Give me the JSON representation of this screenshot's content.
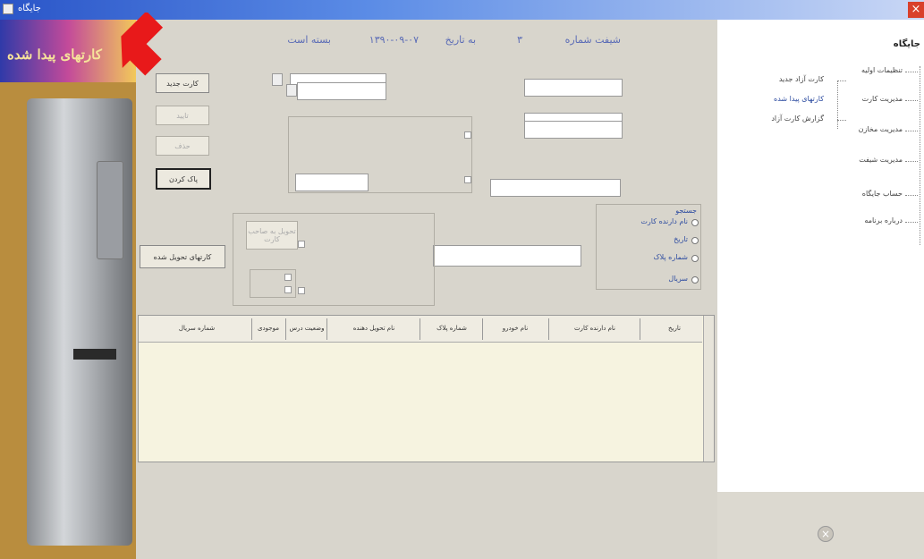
{
  "window": {
    "title": "جایگاه",
    "close_glyph": "×"
  },
  "status_bar": {
    "shift_label": "شیفت شماره",
    "shift_number": "۳",
    "date_label": "به تاریخ",
    "date_value": "۱۳۹۰-۰۹-۰۷",
    "closed_label": "بسته است"
  },
  "banner": {
    "text": "کارتهای پیدا شده"
  },
  "buttons": {
    "new_card": "کارت جدید",
    "save": "تایید",
    "delete": "حذف",
    "clear": "پاک کردن",
    "delivered_cards": "کارتهای تحویل شده",
    "deliver_to_owner": "تحویل به صاحب کارت"
  },
  "filter_group": {
    "title": "جستجو",
    "options": [
      "نام دارنده کارت",
      "تاریخ",
      "شماره پلاک",
      "سریال"
    ]
  },
  "grid": {
    "columns": [
      "تاریخ",
      "نام دارنده کارت",
      "نام خودرو",
      "شماره پلاک",
      "نام تحویل دهنده",
      "وضعیت درس",
      "موجودی",
      "شماره سریال"
    ]
  },
  "tree": {
    "root": "جایگاه",
    "items": [
      "تنظیمات اولیه",
      "مدیریت کارت",
      "مدیریت مخازن",
      "مدیریت شیفت",
      "حساب جایگاه",
      "درباره برنامه"
    ],
    "card_children": [
      "کارت آزاد جدید",
      "کارتهای پیدا شده",
      "گزارش کارت آزاد"
    ]
  },
  "colors": {
    "accent": "#2c4ba0",
    "status_text": "#5a6bb6",
    "arrow": "#e8191a"
  }
}
